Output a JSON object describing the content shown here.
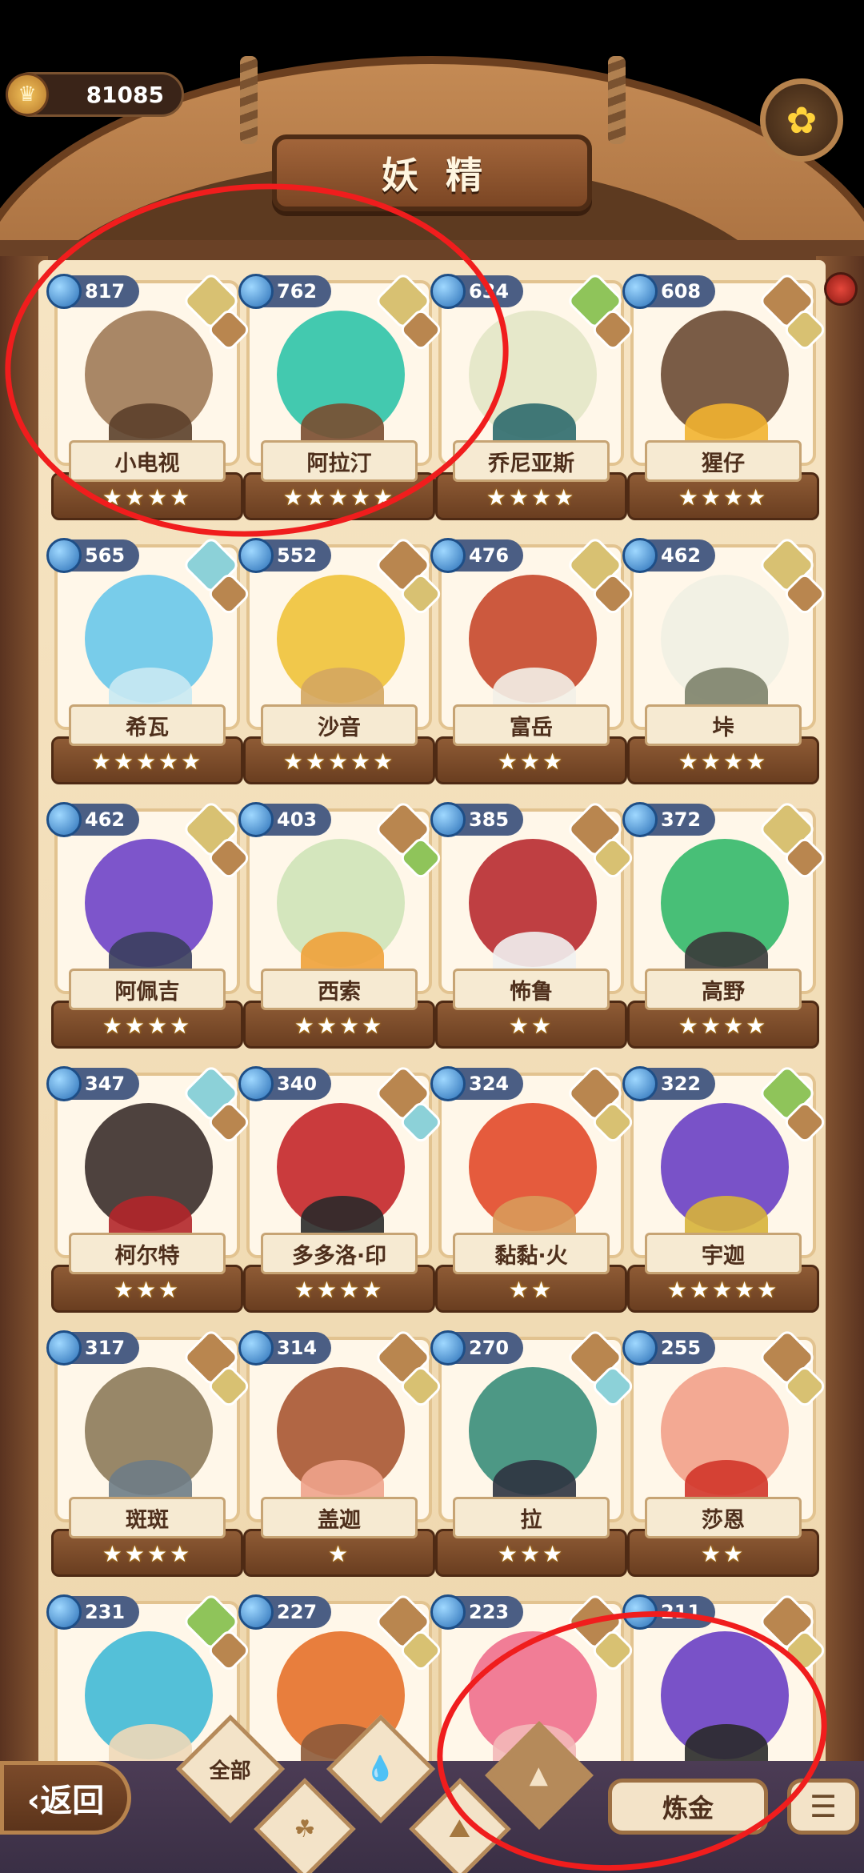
{
  "top": {
    "coins": "81085",
    "title": "妖精"
  },
  "fairies": [
    {
      "name": "小电视",
      "power": "817",
      "stars": "★★★★",
      "col": 0,
      "row": 0,
      "c1": "#a07a58",
      "c2": "#5b3f2a",
      "elems": [
        "el-sand",
        "el-rock"
      ]
    },
    {
      "name": "阿拉汀",
      "power": "762",
      "stars": "★★★★★",
      "col": 1,
      "row": 0,
      "c1": "#2fc3a8",
      "c2": "#7a4d30",
      "elems": [
        "el-sand",
        "el-rock"
      ]
    },
    {
      "name": "乔尼亚斯",
      "power": "634",
      "stars": "★★★★",
      "col": 2,
      "row": 0,
      "c1": "#e3e5c6",
      "c2": "#2d6a6d",
      "elems": [
        "el-leaf",
        "el-rock"
      ]
    },
    {
      "name": "猩仔",
      "power": "608",
      "stars": "★★★★",
      "col": 3,
      "row": 0,
      "c1": "#6b4a34",
      "c2": "#f2b230",
      "elems": [
        "el-rock",
        "el-sand"
      ]
    },
    {
      "name": "希瓦",
      "power": "565",
      "stars": "★★★★★",
      "col": 0,
      "row": 1,
      "c1": "#69c6ea",
      "c2": "#c9e9f3",
      "elems": [
        "el-water",
        "el-rock"
      ]
    },
    {
      "name": "沙音",
      "power": "552",
      "stars": "★★★★★",
      "col": 1,
      "row": 1,
      "c1": "#f0c23a",
      "c2": "#d4a661",
      "elems": [
        "el-rock",
        "el-sand"
      ]
    },
    {
      "name": "富岳",
      "power": "476",
      "stars": "★★★",
      "col": 2,
      "row": 1,
      "c1": "#c7472b",
      "c2": "#f3f0e8",
      "elems": [
        "el-sand",
        "el-rock"
      ]
    },
    {
      "name": "垰",
      "power": "462",
      "stars": "★★★★",
      "col": 3,
      "row": 1,
      "c1": "#f1efe3",
      "c2": "#7d826a",
      "elems": [
        "el-sand",
        "el-rock"
      ]
    },
    {
      "name": "阿佩吉",
      "power": "462",
      "stars": "★★★★",
      "col": 0,
      "row": 2,
      "c1": "#6f43c8",
      "c2": "#3b3f5e",
      "elems": [
        "el-sand",
        "el-rock"
      ]
    },
    {
      "name": "西索",
      "power": "403",
      "stars": "★★★★",
      "col": 1,
      "row": 2,
      "c1": "#cfe3b8",
      "c2": "#f0a13a",
      "elems": [
        "el-rock",
        "el-leaf"
      ]
    },
    {
      "name": "怖鲁",
      "power": "385",
      "stars": "★★",
      "col": 2,
      "row": 2,
      "c1": "#b82a30",
      "c2": "#f1f1f1",
      "elems": [
        "el-rock",
        "el-sand"
      ]
    },
    {
      "name": "高野",
      "power": "372",
      "stars": "★★★★",
      "col": 3,
      "row": 2,
      "c1": "#34b86a",
      "c2": "#3a3a3a",
      "elems": [
        "el-sand",
        "el-rock"
      ]
    },
    {
      "name": "柯尔特",
      "power": "347",
      "stars": "★★★",
      "col": 0,
      "row": 3,
      "c1": "#3b2d2b",
      "c2": "#b3262a",
      "elems": [
        "el-water",
        "el-rock"
      ]
    },
    {
      "name": "多多洛·印",
      "power": "340",
      "stars": "★★★★",
      "col": 1,
      "row": 3,
      "c1": "#c4262a",
      "c2": "#2a2a2a",
      "elems": [
        "el-rock",
        "el-water"
      ]
    },
    {
      "name": "黏黏·火",
      "power": "324",
      "stars": "★★",
      "col": 2,
      "row": 3,
      "c1": "#e2492a",
      "c2": "#d89a5a",
      "elems": [
        "el-rock",
        "el-sand"
      ]
    },
    {
      "name": "宇迦",
      "power": "322",
      "stars": "★★★★★",
      "col": 3,
      "row": 3,
      "c1": "#6a3fc4",
      "c2": "#d7b23a",
      "elems": [
        "el-leaf",
        "el-rock"
      ]
    },
    {
      "name": "斑斑",
      "power": "317",
      "stars": "★★★★",
      "col": 0,
      "row": 4,
      "c1": "#8d7a5a",
      "c2": "#6e7c86",
      "elems": [
        "el-rock",
        "el-sand"
      ]
    },
    {
      "name": "盖迦",
      "power": "314",
      "stars": "★",
      "col": 1,
      "row": 4,
      "c1": "#a85532",
      "c2": "#f0a38c",
      "elems": [
        "el-rock",
        "el-sand"
      ]
    },
    {
      "name": "拉",
      "power": "270",
      "stars": "★★★",
      "col": 2,
      "row": 4,
      "c1": "#3a8d7a",
      "c2": "#2f3340",
      "elems": [
        "el-rock",
        "el-water"
      ]
    },
    {
      "name": "莎恩",
      "power": "255",
      "stars": "★★",
      "col": 3,
      "row": 4,
      "c1": "#f2a08a",
      "c2": "#d2352a",
      "elems": [
        "el-rock",
        "el-sand"
      ]
    },
    {
      "name": "",
      "power": "231",
      "stars": "",
      "col": 0,
      "row": 5,
      "c1": "#41b9d6",
      "c2": "#f0d8b8",
      "elems": [
        "el-leaf",
        "el-rock"
      ]
    },
    {
      "name": "",
      "power": "227",
      "stars": "",
      "col": 1,
      "row": 5,
      "c1": "#e6702a",
      "c2": "#8d5a3a",
      "elems": [
        "el-rock",
        "el-sand"
      ]
    },
    {
      "name": "",
      "power": "223",
      "stars": "",
      "col": 2,
      "row": 5,
      "c1": "#f06f8d",
      "c2": "#f3b8b8",
      "elems": [
        "el-rock",
        "el-sand"
      ]
    },
    {
      "name": "",
      "power": "211",
      "stars": "",
      "col": 3,
      "row": 5,
      "c1": "#6a3fc4",
      "c2": "#2a2a2a",
      "elems": [
        "el-rock",
        "el-sand"
      ]
    }
  ],
  "bottom": {
    "back": "‹返回",
    "all": "全部",
    "alchemy": "炼金",
    "menu": "☰"
  }
}
